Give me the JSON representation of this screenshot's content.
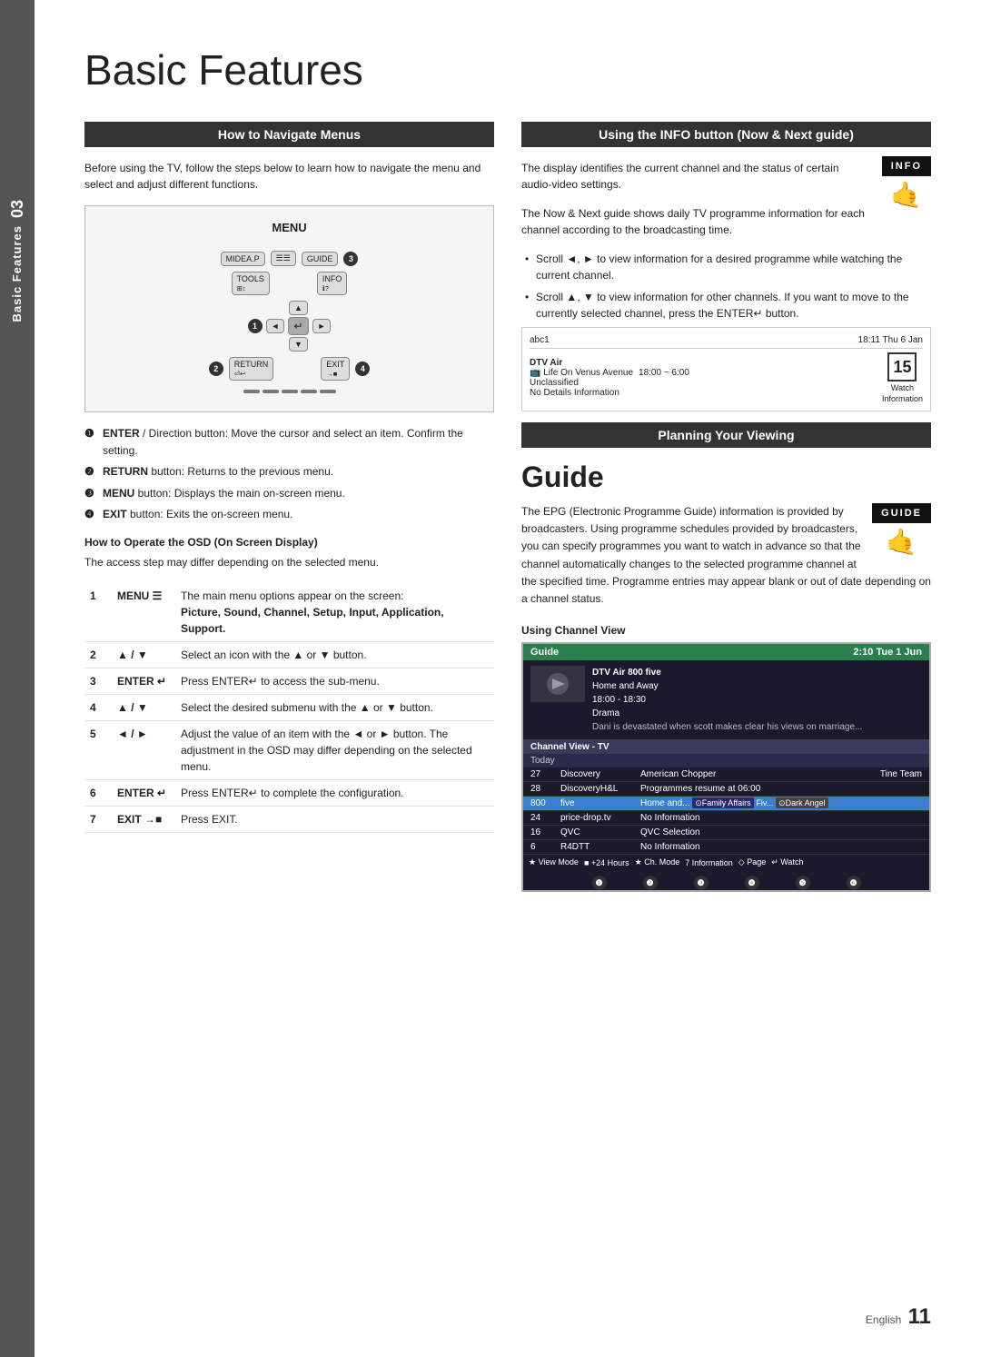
{
  "page": {
    "title": "Basic Features",
    "footer": {
      "lang": "English",
      "page_num": "11"
    }
  },
  "side_tab": {
    "number": "03",
    "label": "Basic Features"
  },
  "left_col": {
    "section1": {
      "header": "How to Navigate Menus",
      "intro": "Before using the TV, follow the steps below to learn how to navigate the menu and select and adjust different functions.",
      "diagram_label": "MENU",
      "bullets": [
        {
          "marker": "❶",
          "text": "ENTER  / Direction button: Move the cursor and select an item. Confirm the setting."
        },
        {
          "marker": "❷",
          "text": "RETURN button: Returns to the previous menu."
        },
        {
          "marker": "❸",
          "text": "MENU button: Displays the main on-screen menu."
        },
        {
          "marker": "❹",
          "text": "EXIT button: Exits the on-screen menu."
        }
      ],
      "osd_title": "How to Operate the OSD (On Screen Display)",
      "osd_intro": "The access step may differ depending on the selected menu.",
      "steps": [
        {
          "num": "1",
          "icon": "MENU  ☰",
          "desc": "The main menu options appear on the screen:\nPicture, Sound, Channel, Setup, Input, Application, Support."
        },
        {
          "num": "2",
          "icon": "▲ / ▼",
          "desc": "Select an icon with the ▲ or ▼ button."
        },
        {
          "num": "3",
          "icon": "ENTER  ↵",
          "desc": "Press ENTER  to access the sub-menu."
        },
        {
          "num": "4",
          "icon": "▲ / ▼",
          "desc": "Select the desired submenu with the ▲ or ▼ button."
        },
        {
          "num": "5",
          "icon": "◄ / ►",
          "desc": "Adjust the value of an item with the ◄ or ► button. The adjustment in the OSD may differ depending on the selected menu."
        },
        {
          "num": "6",
          "icon": "ENTER  ↵",
          "desc": "Press ENTER  to complete the configuration."
        },
        {
          "num": "7",
          "icon": "EXIT →■",
          "desc": "Press EXIT."
        }
      ]
    }
  },
  "right_col": {
    "section1": {
      "header": "Using the INFO button (Now & Next guide)",
      "intro": "The display identifies the current channel and the status of certain audio-video settings.",
      "para2": "The Now & Next guide shows daily TV programme information for each channel according to the broadcasting time.",
      "scroll_bullets": [
        "Scroll ◄, ► to view information for a desired programme while watching the current channel.",
        "Scroll ▲, ▼ to view information for other channels. If you want to move to the currently selected channel, press the ENTER↵ button."
      ],
      "info_box": {
        "channel": "abc1",
        "time": "18:11 Thu 6 Jan",
        "channel2": "DTV Air",
        "prog": "Life On Venus Avenue",
        "time_range": "18:00 ~ 6:00",
        "sub_channel": "Unclassified",
        "no_details": "No Details Information",
        "num": "15",
        "watch_label": "Watch",
        "information_label": "Information"
      }
    },
    "section2": {
      "header": "Planning Your Viewing"
    },
    "guide": {
      "title": "Guide",
      "body": "The EPG (Electronic Programme Guide) information is provided by broadcasters. Using programme schedules provided by broadcasters, you can specify programmes you want to watch in advance so that the channel automatically changes to the selected programme channel at the specified time. Programme entries may appear blank or out of date depending on a channel status.",
      "channel_view_label": "Using  Channel View",
      "cv_header_left": "Guide",
      "cv_header_right": "2:10 Tue 1 Jun",
      "cv_info": {
        "title": "DTV Air 800 five",
        "subtitle": "Home and Away",
        "time": "18:00 - 18:30",
        "genre": "Drama",
        "desc": "Dani is devastated when scott makes clear his views on marriage..."
      },
      "cv_list_header": "Channel View - TV",
      "cv_today": "Today",
      "cv_rows": [
        {
          "num": "27",
          "name": "Discovery",
          "prog": "American Chopper",
          "extra": "Tine Team"
        },
        {
          "num": "28",
          "name": "DiscoveryH&L",
          "prog": "Programmes resume at 06:00",
          "extra": ""
        },
        {
          "num": "800",
          "name": "five",
          "prog": "Home and...",
          "extra": "Family Affairs | Fiv... | Dark Angel",
          "highlight": true
        },
        {
          "num": "24",
          "name": "price-drop.tv",
          "prog": "No Information",
          "extra": ""
        },
        {
          "num": "16",
          "name": "QVC",
          "prog": "QVC Selection",
          "extra": ""
        },
        {
          "num": "6",
          "name": "R4DTT",
          "prog": "No Information",
          "extra": ""
        }
      ],
      "cv_footer_items": [
        "★ View Mode",
        "■ +24 Hours",
        "★ Ch. Mode",
        "7 Information",
        "◇ Page",
        "↵ Watch"
      ],
      "cv_numbers": [
        "❶",
        "❷",
        "❸",
        "❹",
        "❺",
        "❻"
      ]
    }
  }
}
